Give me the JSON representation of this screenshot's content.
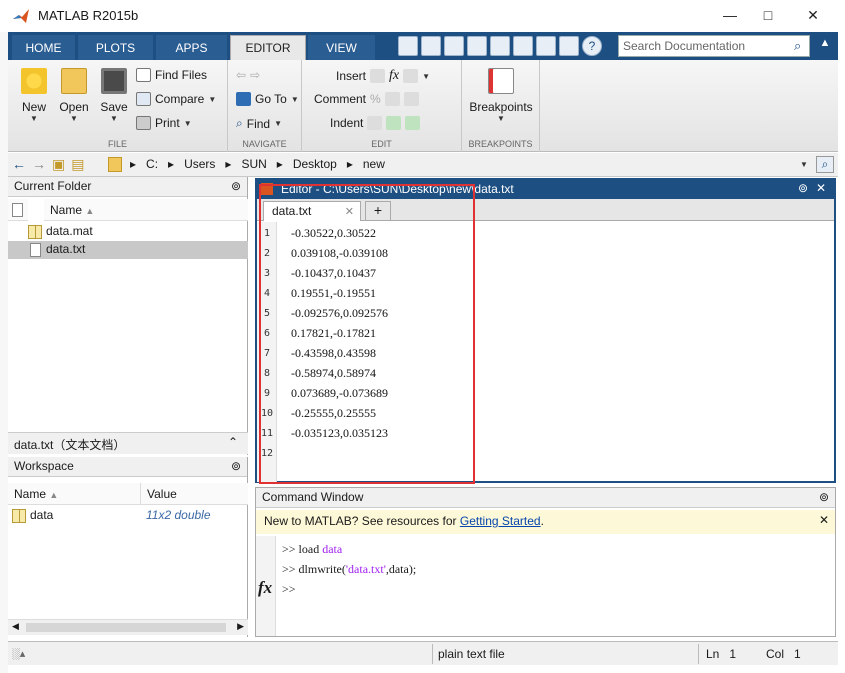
{
  "window": {
    "title": "MATLAB R2015b"
  },
  "tabs": [
    {
      "label": "HOME"
    },
    {
      "label": "PLOTS"
    },
    {
      "label": "APPS"
    },
    {
      "label": "EDITOR",
      "active": true
    },
    {
      "label": "VIEW"
    }
  ],
  "search": {
    "placeholder": "Search Documentation"
  },
  "ribbon": {
    "file": {
      "label": "FILE",
      "new": "New",
      "open": "Open",
      "save": "Save",
      "find_files": "Find Files",
      "compare": "Compare",
      "print": "Print"
    },
    "navigate": {
      "label": "NAVIGATE",
      "go_to": "Go To",
      "find": "Find"
    },
    "edit": {
      "label": "EDIT",
      "insert": "Insert",
      "comment": "Comment",
      "indent": "Indent"
    },
    "breakpoints": {
      "label": "BREAKPOINTS",
      "button": "Breakpoints"
    }
  },
  "address": {
    "segments": [
      "C:",
      "Users",
      "SUN",
      "Desktop",
      "new"
    ]
  },
  "current_folder": {
    "title": "Current Folder",
    "col_name": "Name",
    "files": [
      {
        "name": "data.mat",
        "icon": "mat-file-icon"
      },
      {
        "name": "data.txt",
        "icon": "text-file-icon",
        "selected": true
      }
    ],
    "detail": "data.txt（文本文档）"
  },
  "workspace": {
    "title": "Workspace",
    "col_name": "Name",
    "col_value": "Value",
    "vars": [
      {
        "name": "data",
        "value": "11x2 double"
      }
    ]
  },
  "editor": {
    "title": "Editor - C:\\Users\\SUN\\Desktop\\new\\data.txt",
    "tab": "data.txt",
    "lines": [
      "-0.30522,0.30522",
      "0.039108,-0.039108",
      "-0.10437,0.10437",
      "0.19551,-0.19551",
      "-0.092576,0.092576",
      "0.17821,-0.17821",
      "-0.43598,0.43598",
      "-0.58974,0.58974",
      "0.073689,-0.073689",
      "-0.25555,0.25555",
      "-0.035123,0.035123",
      ""
    ],
    "line_numbers": [
      "1",
      "2",
      "3",
      "4",
      "5",
      "6",
      "7",
      "8",
      "9",
      "10",
      "11",
      "12"
    ]
  },
  "command_window": {
    "title": "Command Window",
    "banner_prefix": "New to MATLAB? See resources for ",
    "banner_link": "Getting Started",
    "banner_suffix": ".",
    "history": [
      {
        "prompt": ">> ",
        "cmd": "load ",
        "arg": "data",
        "rest": ""
      },
      {
        "prompt": ">> ",
        "cmd": "dlmwrite(",
        "arg": "'data.txt'",
        "rest": ",data);"
      }
    ],
    "current_prompt": ">>",
    "fx": "fx"
  },
  "status": {
    "file_type": "plain text file",
    "ln_label": "Ln",
    "ln": "1",
    "col_label": "Col",
    "col": "1"
  },
  "colors": {
    "accent": "#1d4f82",
    "highlight": "#e03232",
    "banner": "#fdf8d8"
  }
}
